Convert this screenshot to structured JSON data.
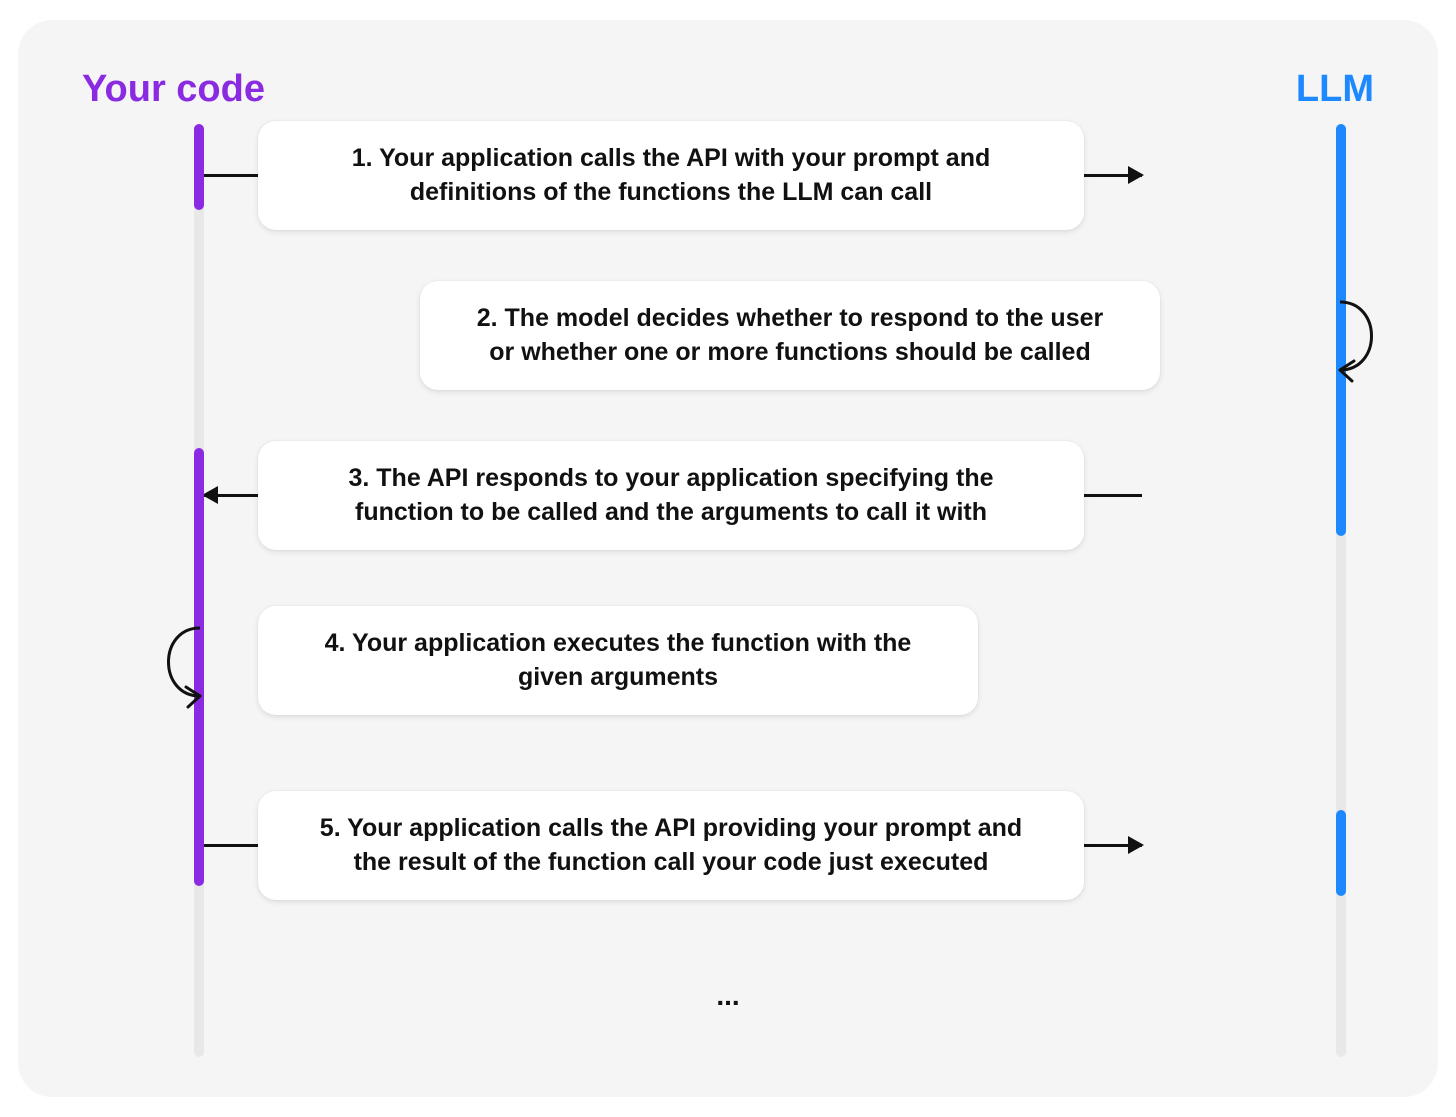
{
  "headers": {
    "left": "Your code",
    "right": "LLM"
  },
  "colors": {
    "your_code": "#8a2be2",
    "llm": "#1e88ff",
    "lifeline_idle": "#e8e8e8",
    "panel_bg": "#f5f5f5"
  },
  "steps": [
    {
      "n": 1,
      "text": "1. Your application calls the API with your prompt and definitions of the functions the LLM can call",
      "from": "code",
      "to": "llm",
      "kind": "message"
    },
    {
      "n": 2,
      "text": "2. The model decides whether to respond to the user or whether one or more functions should be called",
      "from": "llm",
      "to": "llm",
      "kind": "self"
    },
    {
      "n": 3,
      "text": "3. The API responds to your application specifying the function to be called and the arguments to call it with",
      "from": "llm",
      "to": "code",
      "kind": "message"
    },
    {
      "n": 4,
      "text": "4. Your application executes the function with the given  arguments",
      "from": "code",
      "to": "code",
      "kind": "self"
    },
    {
      "n": 5,
      "text": "5. Your application calls the API providing your prompt and the result of the function call your code just executed",
      "from": "code",
      "to": "llm",
      "kind": "message"
    }
  ],
  "continuation": "..."
}
